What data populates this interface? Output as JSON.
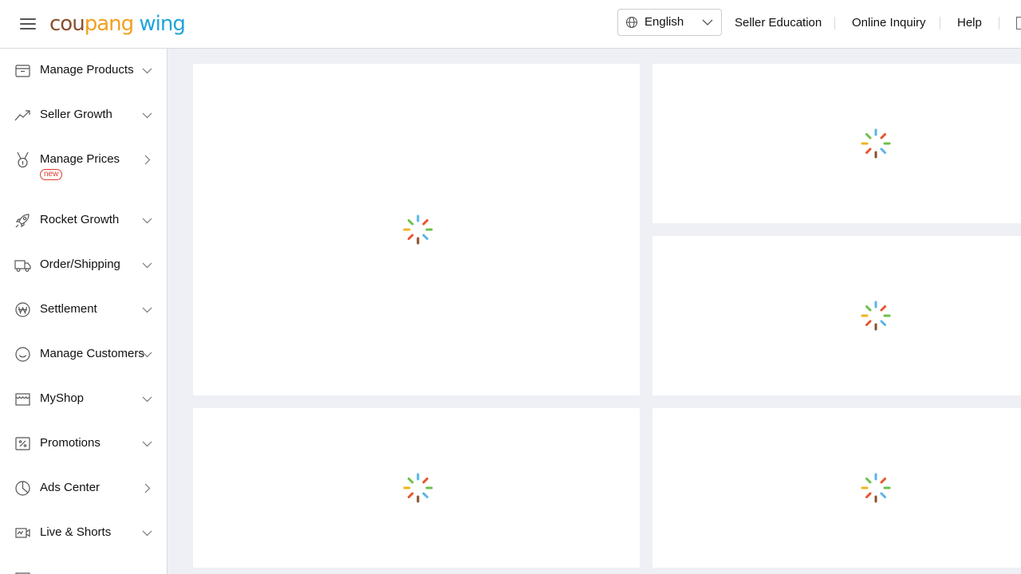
{
  "header": {
    "logo_part1": "cou",
    "logo_part2": "pang",
    "logo_part3": " wing",
    "language": "English",
    "links": [
      "Seller Education",
      "Online Inquiry",
      "Help"
    ]
  },
  "sidebar": {
    "items": [
      {
        "label": "Manage Products",
        "icon": "box-icon",
        "arrow": "chevron-down-icon"
      },
      {
        "label": "Seller Growth",
        "icon": "trend-up-icon",
        "arrow": "chevron-down-icon"
      },
      {
        "label": "Manage Prices",
        "icon": "medal-icon",
        "arrow": "chevron-right-icon",
        "badge": "new"
      },
      {
        "label": "Rocket Growth",
        "icon": "rocket-icon",
        "arrow": "chevron-down-icon"
      },
      {
        "label": "Order/Shipping",
        "icon": "truck-icon",
        "arrow": "chevron-down-icon"
      },
      {
        "label": "Settlement",
        "icon": "won-coin-icon",
        "arrow": "chevron-down-icon"
      },
      {
        "label": "Manage Customers",
        "icon": "smiley-icon",
        "arrow": "chevron-down-icon"
      },
      {
        "label": "MyShop",
        "icon": "storefront-icon",
        "arrow": "chevron-down-icon"
      },
      {
        "label": "Promotions",
        "icon": "discount-icon",
        "arrow": "chevron-down-icon"
      },
      {
        "label": "Ads Center",
        "icon": "pie-chart-icon",
        "arrow": "chevron-right-icon"
      },
      {
        "label": "Live & Shorts",
        "icon": "live-video-icon",
        "arrow": "chevron-down-icon"
      }
    ]
  },
  "colors": {
    "logo_brown": "#8a4f2c",
    "logo_orange": "#f0a11f",
    "logo_blue": "#20a5d8",
    "badge_red": "#e03a2a",
    "page_bg": "#eef0f5"
  },
  "main": {
    "cards_state": "loading"
  }
}
